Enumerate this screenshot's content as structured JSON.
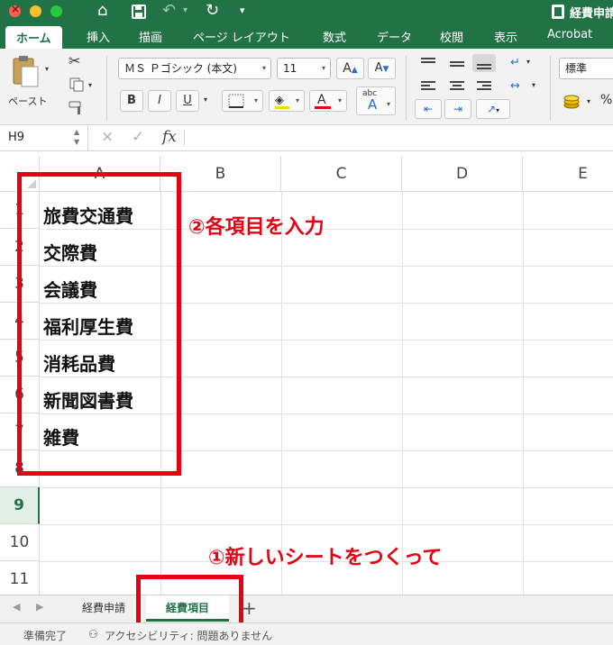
{
  "window": {
    "title": "経費申請"
  },
  "ribbon": {
    "tabs": [
      "ホーム",
      "挿入",
      "描画",
      "ページ レイアウト",
      "数式",
      "データ",
      "校閲",
      "表示",
      "Acrobat"
    ],
    "paste_label": "ペースト",
    "font_name": "ＭＳ Ｐゴシック (本文)",
    "font_size": "11",
    "bold": "B",
    "italic": "I",
    "underline": "U",
    "font_color_letter": "A",
    "grow_font": "A",
    "shrink_font": "A",
    "phonetic_small": "abc",
    "phonetic_big": "A",
    "number_format": "標準",
    "percent": "%",
    "font_color": "#e60012",
    "accent": "#217346"
  },
  "formula_bar": {
    "name_box": "H9",
    "cancel": "×",
    "enter": "✓",
    "fx": "fx",
    "formula": ""
  },
  "sheet": {
    "columns": [
      "A",
      "B",
      "C",
      "D",
      "E"
    ],
    "rows": [
      "1",
      "2",
      "3",
      "4",
      "5",
      "6",
      "7",
      "8",
      "9",
      "10",
      "11"
    ],
    "column_a": [
      "旅費交通費",
      "交際費",
      "会議費",
      "福利厚生費",
      "消耗品費",
      "新聞図書費",
      "雑費"
    ],
    "selected_row": "9"
  },
  "annotations": {
    "step2": "②各項目を入力",
    "step1": "①新しいシートをつくって",
    "color": "#e60012"
  },
  "sheet_tabs": {
    "tabs": [
      "経費申請",
      "経費項目"
    ],
    "active": "経費項目",
    "add": "+"
  },
  "status_bar": {
    "ready": "準備完了",
    "accessibility": "アクセシビリティ: 問題ありません"
  }
}
